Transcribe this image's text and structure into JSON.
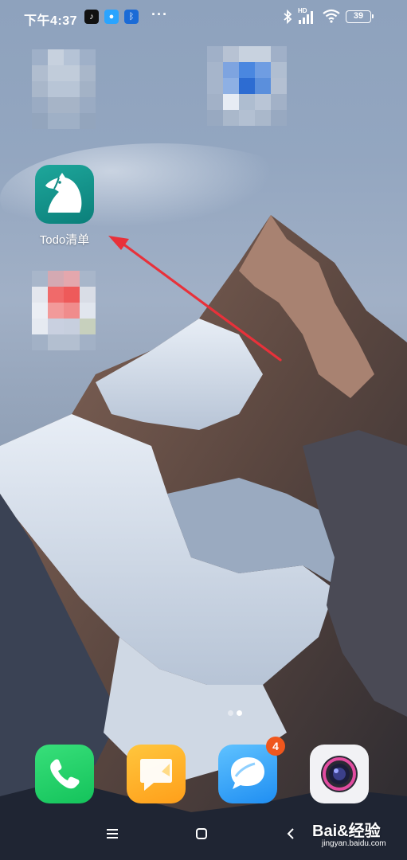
{
  "status_bar": {
    "time": "下午4:37",
    "notification_icons": [
      "tiktok-icon",
      "message-icon",
      "bluetooth-icon"
    ],
    "more": "···",
    "hd": "HD",
    "battery_level": "39"
  },
  "home": {
    "apps": [
      {
        "name": "pixelated-app-1",
        "label": ""
      },
      {
        "name": "pixelated-app-2",
        "label": ""
      },
      {
        "name": "todo-list",
        "label": "Todo清单"
      },
      {
        "name": "pixelated-app-3",
        "label": ""
      }
    ],
    "annotation": "red-arrow-pointing-to-todo"
  },
  "page_indicator": {
    "pages": 2,
    "current": 2
  },
  "dock": [
    {
      "name": "phone",
      "icon": "phone-icon",
      "badge": ""
    },
    {
      "name": "notes",
      "icon": "notes-icon",
      "badge": ""
    },
    {
      "name": "messages",
      "icon": "chat-bubble-icon",
      "badge": "4"
    },
    {
      "name": "camera",
      "icon": "camera-icon",
      "badge": ""
    }
  ],
  "nav_bar": {
    "buttons": [
      "menu-icon",
      "home-icon",
      "back-icon"
    ]
  },
  "watermark": {
    "brand": "Bai&经验",
    "url": "jingyan.baidu.com"
  },
  "colors": {
    "todo_icon": "#1ea79b",
    "phone": "#2ad36b",
    "notes": "#ffb42a",
    "messages": "#3aa8ff",
    "badge": "#f0571d",
    "arrow": "#e8313a"
  }
}
